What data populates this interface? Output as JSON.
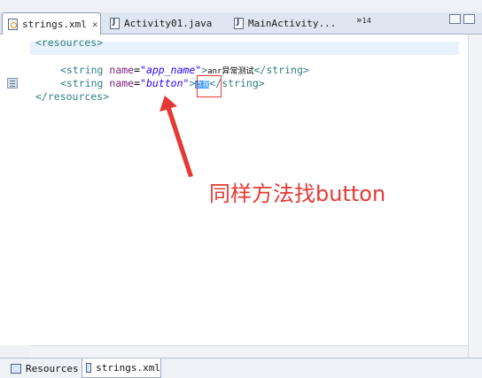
{
  "editor_tabs": [
    {
      "label": "strings.xml",
      "icon": "xml-file-icon",
      "active": true,
      "close": "✕"
    },
    {
      "label": "Activity01.java",
      "icon": "java-file-icon",
      "active": false
    },
    {
      "label": "MainActivity...",
      "icon": "java-file-icon",
      "active": false
    }
  ],
  "overflow": {
    "chevrons": "»",
    "count": "14"
  },
  "code_lines": {
    "l1": "<resources>",
    "l2_open": "<string ",
    "l2_attr": "name",
    "l2_eq": "=",
    "l2_val": "\"app_name\"",
    "l2_gt": ">",
    "l2_text": "anr异常测试",
    "l2_close": "</string>",
    "l3_open": "<string ",
    "l3_attr": "name",
    "l3_eq": "=",
    "l3_val": "\"button\"",
    "l3_gt": ">",
    "l3_text_selected": "点我",
    "l3_close": "</string>",
    "l4": "</resources>"
  },
  "annotation": {
    "text": "同样方法找button",
    "color": "#e53935"
  },
  "bottom_tabs": [
    {
      "label": "Resources",
      "active": false
    },
    {
      "label": "strings.xml",
      "active": true
    }
  ],
  "colors": {
    "tag": "#2f7f7f",
    "attribute": "#7a1e7a",
    "value": "#2a00ff",
    "selection": "#3399ff"
  }
}
